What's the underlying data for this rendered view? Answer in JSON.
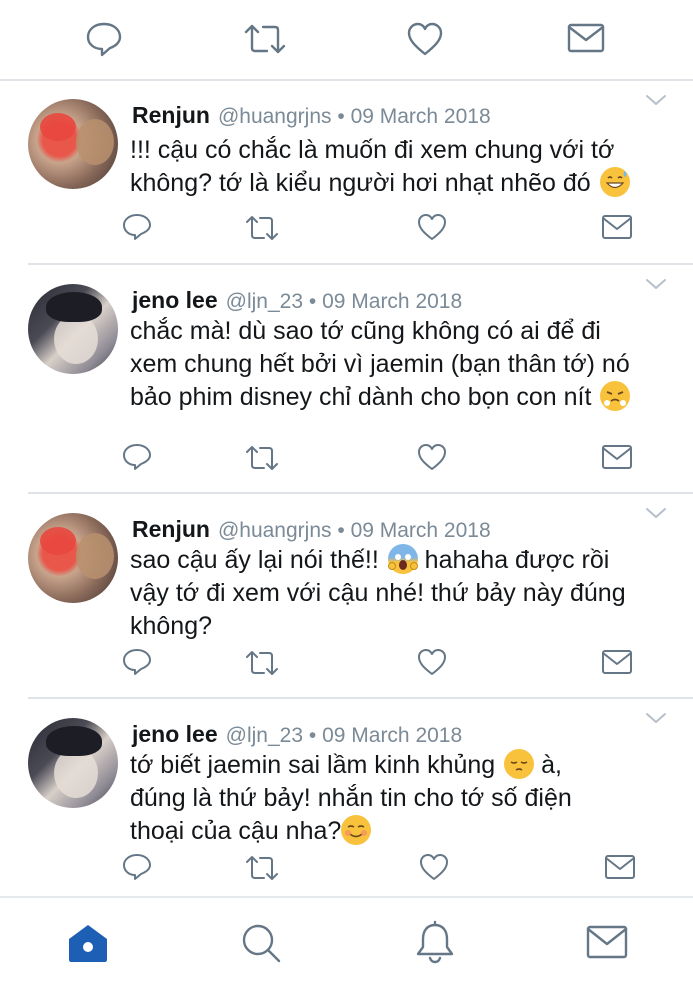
{
  "top_actions": [
    "reply-icon",
    "retweet-icon",
    "like-icon",
    "message-icon"
  ],
  "tweets": [
    {
      "name": "Renjun",
      "handle": "@huangrjns",
      "sep": "•",
      "date": "09 March 2018",
      "lines": [
        "!!! cậu có chắc là muốn đi xem chung với tớ",
        "không? tớ là kiểu người hơi nhạt nhẽo đó"
      ],
      "emoji": "grinning-sweat-emoji"
    },
    {
      "name": "jeno lee",
      "handle": "@ljn_23",
      "sep": "•",
      "date": "09 March 2018",
      "lines": [
        "chắc mà! dù sao tớ cũng không có ai để đi",
        "xem chung hết bởi vì jaemin (bạn thân tớ) nó",
        "bảo phim disney chỉ dành cho bọn con nít"
      ],
      "emoji": "steam-face-emoji"
    },
    {
      "name": "Renjun",
      "handle": "@huangrjns",
      "sep": "•",
      "date": "09 March 2018",
      "lines_pre": "sao cậu ấy lại nói thế!!",
      "lines_post": " hahaha được rồi",
      "lines": [
        "vậy tớ đi xem với cậu nhé! thứ bảy này đúng",
        "không?"
      ],
      "emoji": "screaming-face-emoji"
    },
    {
      "name": "jeno lee",
      "handle": "@ljn_23",
      "sep": "•",
      "date": "09 March 2018",
      "lines_pre": "tớ biết jaemin sai lầm kinh khủng",
      "lines_post": " à,",
      "lines": [
        "đúng là thứ bảy! nhắn tin cho tớ số điện",
        "thoại của cậu nha?"
      ],
      "emoji_mid": "pensive-face-emoji",
      "emoji": "smiling-blush-emoji"
    }
  ],
  "bottom_nav": [
    "home-icon",
    "search-icon",
    "notifications-icon",
    "messages-icon"
  ],
  "colors": {
    "icon_gray": "#657786",
    "home_blue": "#1d5fb4",
    "divider": "#dfe3e8"
  }
}
